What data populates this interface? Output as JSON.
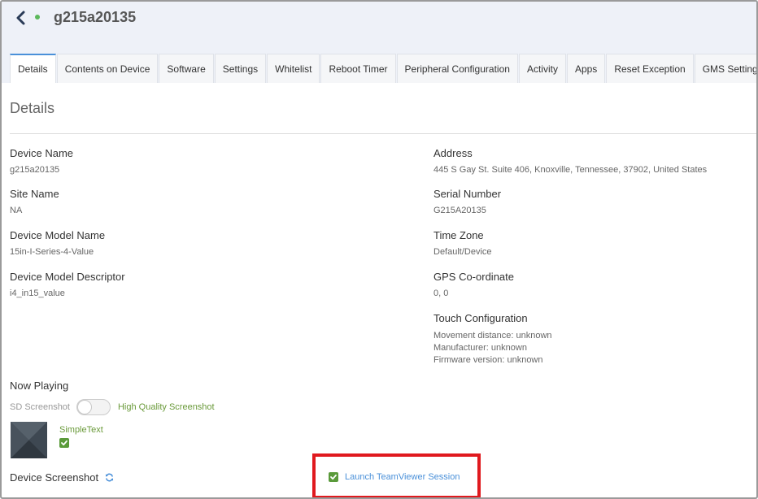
{
  "header": {
    "device_title": "g215a20135",
    "back_icon": "chevron-left-icon",
    "status_color": "#5cb85c"
  },
  "tabs": [
    {
      "label": "Details",
      "active": true
    },
    {
      "label": "Contents on Device"
    },
    {
      "label": "Software"
    },
    {
      "label": "Settings"
    },
    {
      "label": "Whitelist"
    },
    {
      "label": "Reboot Timer"
    },
    {
      "label": "Peripheral Configuration"
    },
    {
      "label": "Activity"
    },
    {
      "label": "Apps"
    },
    {
      "label": "Reset Exception"
    },
    {
      "label": "GMS Settings"
    }
  ],
  "section_title": "Details",
  "left": {
    "device_name": {
      "label": "Device Name",
      "value": "g215a20135"
    },
    "site_name": {
      "label": "Site Name",
      "value": "NA"
    },
    "model_name": {
      "label": "Device Model Name",
      "value": "15in-I-Series-4-Value"
    },
    "model_descriptor": {
      "label": "Device Model Descriptor",
      "value": "i4_in15_value"
    }
  },
  "right": {
    "address": {
      "label": "Address",
      "value": "445 S Gay St. Suite 406, Knoxville, Tennessee, 37902, United States"
    },
    "serial": {
      "label": "Serial Number",
      "value": "G215A20135"
    },
    "timezone": {
      "label": "Time Zone",
      "value": "Default/Device"
    },
    "gps": {
      "label": "GPS Co-ordinate",
      "value": "0, 0"
    },
    "touch": {
      "label": "Touch Configuration",
      "lines": [
        "Movement distance: unknown",
        "Manufacturer: unknown",
        "Firmware version: unknown"
      ]
    }
  },
  "now_playing": {
    "label": "Now Playing",
    "sd_label": "SD Screenshot",
    "hq_label": "High Quality Screenshot",
    "content_name": "SimpleText",
    "content_checked": true
  },
  "device_screenshot": {
    "label": "Device Screenshot",
    "refresh_icon": "refresh-icon"
  },
  "teamviewer": {
    "label": "Launch TeamViewer Session",
    "checked": true,
    "highlight_color": "#e0191e"
  }
}
